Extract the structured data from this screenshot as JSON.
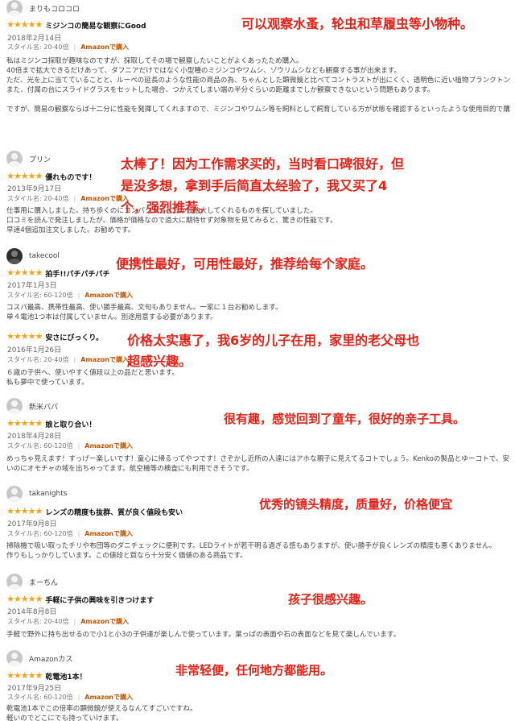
{
  "reviews": [
    {
      "user": "まりもコロコロ",
      "title": "ミジンコの簡易な観察にGood",
      "stars": "★★★★★",
      "date": "2018年2月14日",
      "style": "スタイル名: 20-40倍",
      "verified": "Amazonで購入",
      "paragraphs": [
        "私はミジンコ採取が趣味なのですが、採取してその場で観察したいことがよくあったため購入。",
        "40倍まで拡大できるだけあって、ダフニアだけではなく小型種のミジンコやワムシ、ゾウリムシなども観察する事が出来ます。",
        "ただ、光を上に当てていることと、ルーペの延長のような性能の商品の為、ちゃんとした顕微鏡と比べてコントラストが出にくく、透明色に近い植物プランクトンや、内部の細かい構造の観察は出来ない事があります。",
        "また、付属の台にスライドグラスをセットした場合、つかえてしまい端の半分ぐらいの距離までしか観察できないという問題もあります。",
        "ですが、簡易の観察ならば十二分に性能を発揮してくれますので、ミジンコやワムシ等を飼料として飼育している方が状態を確認するといったような使用目的で購入されるなら満足できる商品だと思います。"
      ],
      "caption": "可以观察水蚤，轮虫和草履虫等小物种。"
    },
    {
      "user": "プリン",
      "title": "優れものです！",
      "stars": "★★★★★",
      "date": "2013年9月17日",
      "style": "スタイル名: 20-40倍",
      "verified": "Amazonで購入",
      "paragraphs": [
        "仕事用に購入しました。持ち歩くのにコンパクトでしっかり拡大してくれるものを探していました。",
        "口コミを読んで発注しましたが、価格が価格なので過大に期待せず対象物を見てみると、驚きの性能です。",
        "早速4個追加注文しました。お勧めです。"
      ],
      "caption_lines": [
        "太棒了！因为工作需求买的，当时看口碑很好，但",
        "是没多想，拿到手后简直太经验了，我又买了4",
        "个，强烈推荐。"
      ]
    },
    {
      "user": "takecool",
      "title": "拍手!!パチパチパチ",
      "stars": "★★★★★",
      "date": "2017年1月3日",
      "style": "スタイル名: 60-120倍",
      "verified": "Amazonで購入",
      "paragraphs": [
        "コスパ最高、携帯性最高、使い勝手最高、文句もありません。一家に１台お勧めします。",
        "単４電池1つ本は付属していません。別途用意する必要があります。"
      ],
      "caption": "便携性最好，可用性最好，推荐给每个家庭。"
    },
    {
      "user": "",
      "title": "安さにびっくり。",
      "stars": "★★★★★",
      "date": "2016年1月26日",
      "style": "スタイル名: 20-40倍",
      "verified": "Amazonで購入",
      "paragraphs": [
        "６歳の子供へ、使いやすく値段以上の品だと思います。",
        "私も夢中で使っています。"
      ],
      "caption_lines": [
        "价格太实惠了，我6岁的儿子在用，家里的老父母也",
        "超感兴趣。"
      ]
    },
    {
      "user": "新米パパ",
      "title": "娘と取り合い！",
      "stars": "★★★★★",
      "date": "2018年4月28日",
      "style": "スタイル名: 60-120倍",
      "verified": "Amazonで購入",
      "paragraphs": [
        "めっちゃ見えます！すっげー楽しいです！童心に帰るってやつです！さぞかし近所の人達にはアホな親子に見えてるコトでしょう。Kenkoの製品とゆーコトで、安いのにオモチャの域を出ちゃってます。航空機等の検査にも利用できそうです。"
      ],
      "caption": "很有趣，感觉回到了童年，很好的亲子工具。"
    },
    {
      "user": "takanights",
      "title": "レンズの精度も抜群、質が良く値段も安い",
      "stars": "★★★★★",
      "date": "2017年9月8日",
      "style": "スタイル名: 60-120倍",
      "verified": "Amazonで購入",
      "paragraphs": [
        "掃除機で吸い取ったチリや布団等のダニチェックに便利です。LEDライトが若干明る過ぎる感もありますが、使い勝手が良くレンズの精度も悪くありません。",
        "作りもしっかりしています。この値段と質なら十分安く価値のある商品です。"
      ],
      "caption": "优秀的镜头精度，质量好，价格便宜"
    },
    {
      "user": "まーちん",
      "title": "手軽に子供の興味を引きつけます",
      "stars": "★★★★★",
      "date": "2014年8月8日",
      "style": "スタイル名: 20-40倍",
      "verified": "Amazonで購入",
      "paragraphs": [
        "手軽で野外に持ち出せるので小1と小3の子供達が楽しんで使っています。葉っぱの表面や石の表面などを見て楽しんでいます。"
      ],
      "caption": "孩子很感兴趣。"
    },
    {
      "user": "Amazonカス",
      "title": "乾電池1本！",
      "stars": "★★★★★",
      "date": "2017年9月25日",
      "style": "スタイル名: 60-120倍",
      "verified": "Amazonで購入",
      "paragraphs": [
        "乾電池1本でこの倍率の顕微鏡が使えるなんてすごいですね。",
        "軽いのでどこにでも持っていけます。"
      ],
      "caption": "非常轻便，任何地方都能用。"
    }
  ]
}
